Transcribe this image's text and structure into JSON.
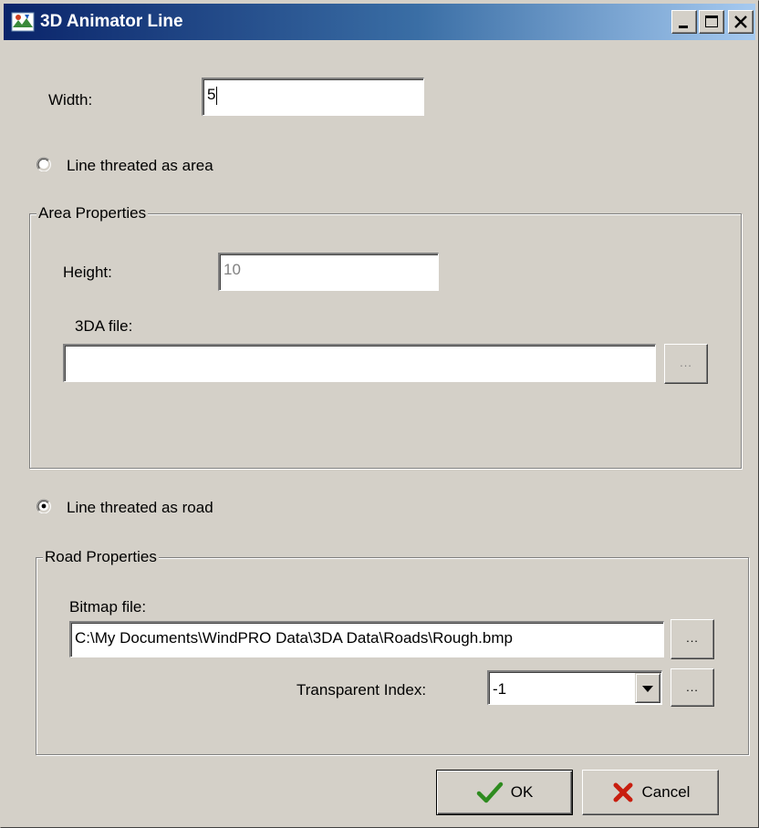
{
  "window": {
    "title": "3D Animator Line",
    "app_icon": "windpro-app-icon",
    "controls": [
      "minimize-icon",
      "maximize-icon",
      "close-icon"
    ]
  },
  "width": {
    "label": "Width:",
    "value": "5"
  },
  "mode": {
    "area_label": "Line threated as area",
    "area_selected": false,
    "road_label": "Line threated as road",
    "road_selected": true
  },
  "area_properties": {
    "legend": "Area Properties",
    "height_label": "Height:",
    "height_value": "10",
    "file_label": "3DA file:",
    "file_value": "",
    "browse_label": "..."
  },
  "road_properties": {
    "legend": "Road Properties",
    "bitmap_label": "Bitmap file:",
    "bitmap_value": "C:\\My Documents\\WindPRO Data\\3DA Data\\Roads\\Rough.bmp",
    "bitmap_browse_label": "...",
    "transparent_label": "Transparent Index:",
    "transparent_value": "-1",
    "transparent_browse_label": "..."
  },
  "buttons": {
    "ok_label": "OK",
    "ok_icon": "checkmark-icon",
    "cancel_label": "Cancel",
    "cancel_icon": "x-icon"
  },
  "colors": {
    "titlebar_start": "#0a246a",
    "titlebar_end": "#a6caf0",
    "dialog_bg": "#d4d0c8",
    "ok_check": "#2e8b1f",
    "cancel_x": "#c81e0f"
  }
}
